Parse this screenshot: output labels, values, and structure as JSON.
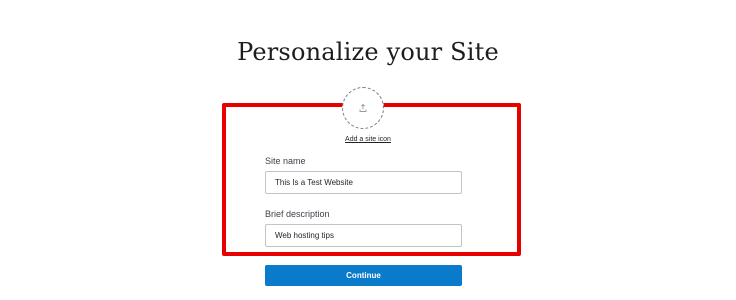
{
  "page_title": "Personalize your Site",
  "site_icon": {
    "icon": "upload-icon",
    "link_label": "Add a site icon"
  },
  "form": {
    "site_name": {
      "label": "Site name",
      "value": "This Is a Test Website"
    },
    "brief_description": {
      "label": "Brief description",
      "value": "Web hosting tips"
    }
  },
  "actions": {
    "continue_label": "Continue"
  },
  "colors": {
    "primary_button": "#0a7acb",
    "highlight_border": "#e60000"
  }
}
